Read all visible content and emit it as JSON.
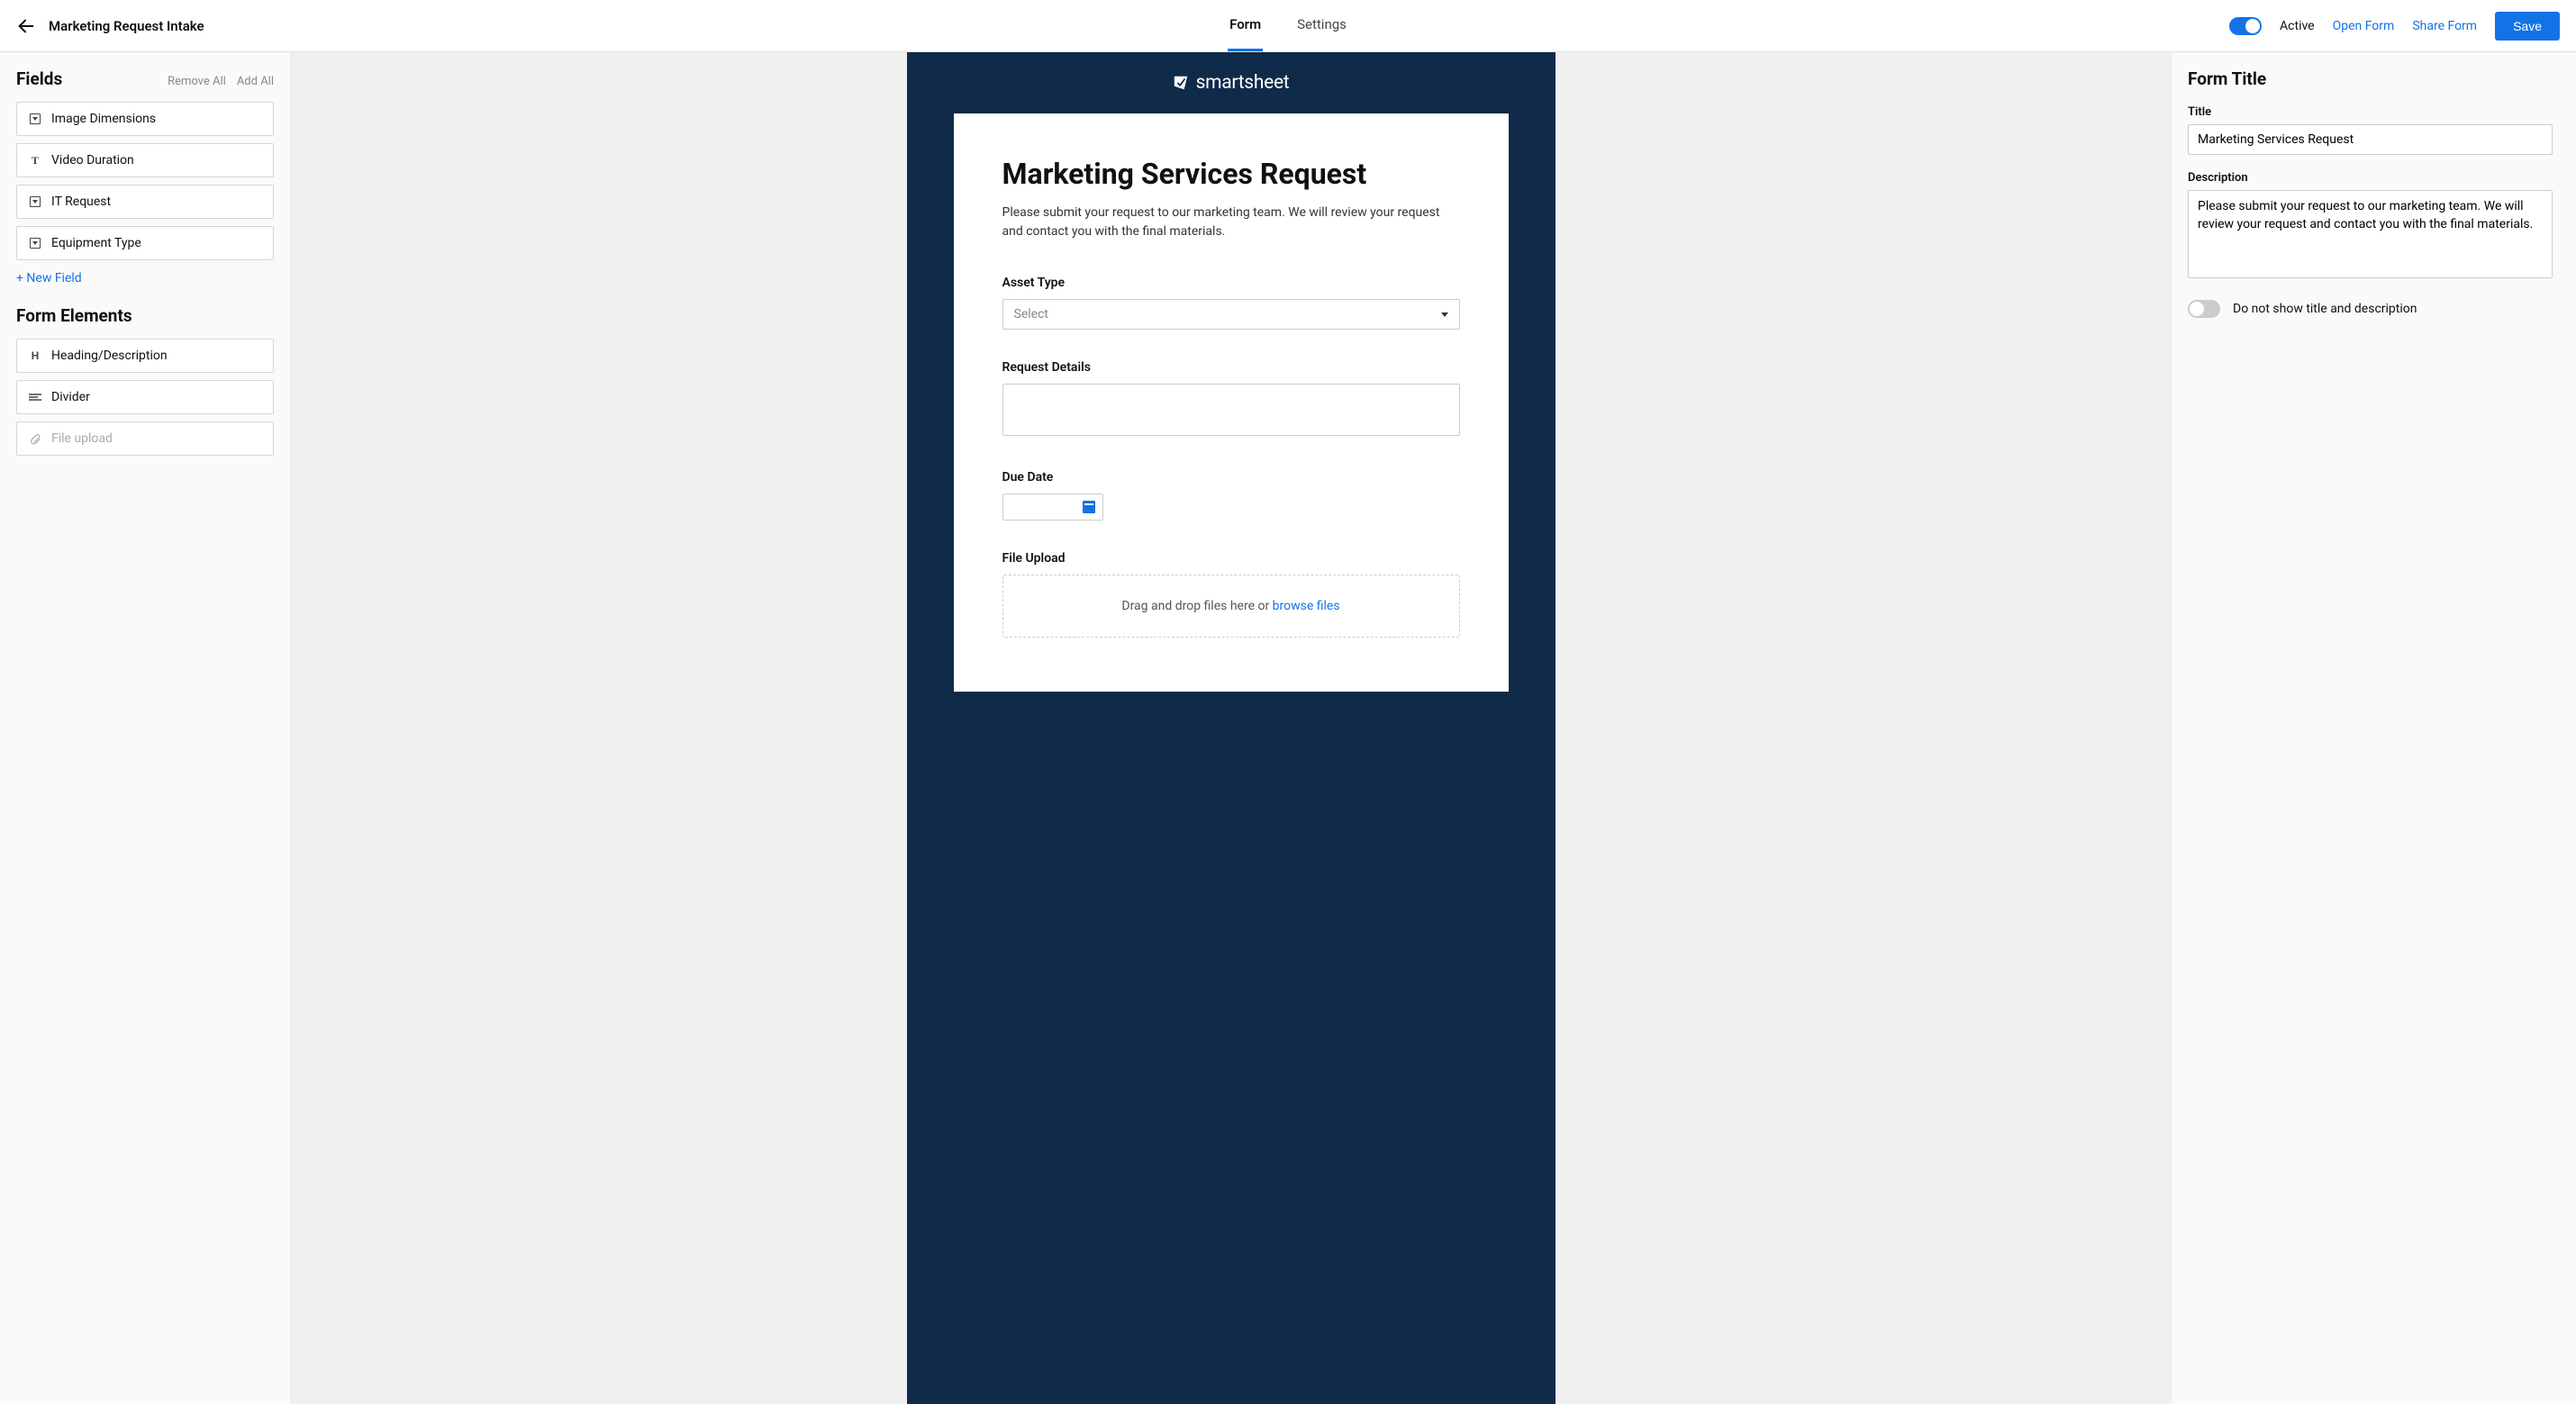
{
  "header": {
    "page_title": "Marketing Request Intake",
    "tabs": {
      "form": "Form",
      "settings": "Settings"
    },
    "active_label": "Active",
    "open_form": "Open Form",
    "share_form": "Share Form",
    "save": "Save"
  },
  "sidebar_left": {
    "fields_heading": "Fields",
    "remove_all": "Remove All",
    "add_all": "Add All",
    "fields": [
      {
        "label": "Image Dimensions",
        "icon": "dropdown"
      },
      {
        "label": "Video Duration",
        "icon": "text"
      },
      {
        "label": "IT Request",
        "icon": "dropdown"
      },
      {
        "label": "Equipment Type",
        "icon": "dropdown"
      }
    ],
    "new_field": "+ New Field",
    "elements_heading": "Form Elements",
    "elements": [
      {
        "label": "Heading/Description",
        "icon": "H"
      },
      {
        "label": "Divider",
        "icon": "divider"
      },
      {
        "label": "File upload",
        "icon": "attach",
        "disabled": true
      }
    ]
  },
  "canvas": {
    "brand": "smartsheet",
    "form_title": "Marketing Services Request",
    "form_desc": "Please submit your request to our marketing team. We will review your request and contact you with the final materials.",
    "f_asset_type": {
      "label": "Asset Type",
      "placeholder": "Select"
    },
    "f_request_details": {
      "label": "Request Details"
    },
    "f_due_date": {
      "label": "Due Date"
    },
    "f_file_upload": {
      "label": "File Upload",
      "drag_text": "Drag and drop files here or ",
      "browse": "browse files"
    }
  },
  "sidebar_right": {
    "heading": "Form Title",
    "title_label": "Title",
    "title_value": "Marketing Services Request",
    "desc_label": "Description",
    "desc_value": "Please submit your request to our marketing team. We will review your request and contact you with the final materials.",
    "hide_toggle_label": "Do not show title and description"
  }
}
